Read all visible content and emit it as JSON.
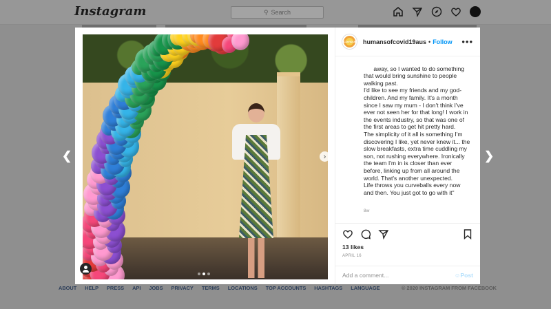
{
  "nav": {
    "logo": "Instagram",
    "search_placeholder": "Search"
  },
  "post": {
    "username": "humansofcovid19aus",
    "follow_label": "Follow",
    "dot": "•",
    "more": "•••",
    "avatar_text": "COVID19",
    "caption": "away, so I wanted to do something that would bring sunshine to people walking past.\nI'd like to see my friends and my god-children. And my family. It's a month since I saw my mum - I don't think I've ever not seen her for that long! I work in the events industry, so that was one of the first areas to get hit pretty hard.\nThe simplicity of it all is something I'm discovering I like, yet never knew it... the slow breakfasts, extra time cuddling my son, not rushing everywhere. Ironically the team I'm in is closer than ever before, linking up from all around the world. That's another unexpected.\nLife throws you curveballs every now and then. You just got to go with it\"",
    "caption_age": "8w",
    "likes": "13 likes",
    "date": "APRIL 16",
    "comment_placeholder": "Add a comment...",
    "post_label": "Post",
    "carousel": {
      "slides": 3,
      "active": 1
    }
  },
  "footer": {
    "links": [
      "ABOUT",
      "HELP",
      "PRESS",
      "API",
      "JOBS",
      "PRIVACY",
      "TERMS",
      "LOCATIONS",
      "TOP ACCOUNTS",
      "HASHTAGS",
      "LANGUAGE"
    ],
    "copyright": "© 2020 INSTAGRAM FROM FACEBOOK"
  },
  "icons": {
    "nav": [
      "home-icon",
      "direct-icon",
      "explore-icon",
      "heart-icon",
      "profile-avatar"
    ],
    "actions": [
      "like-icon",
      "comment-icon",
      "share-icon",
      "save-icon"
    ]
  },
  "colors": {
    "accent": "#0095f6",
    "post_disabled": "#b2dffc",
    "overlay": "#8f8f8f"
  }
}
